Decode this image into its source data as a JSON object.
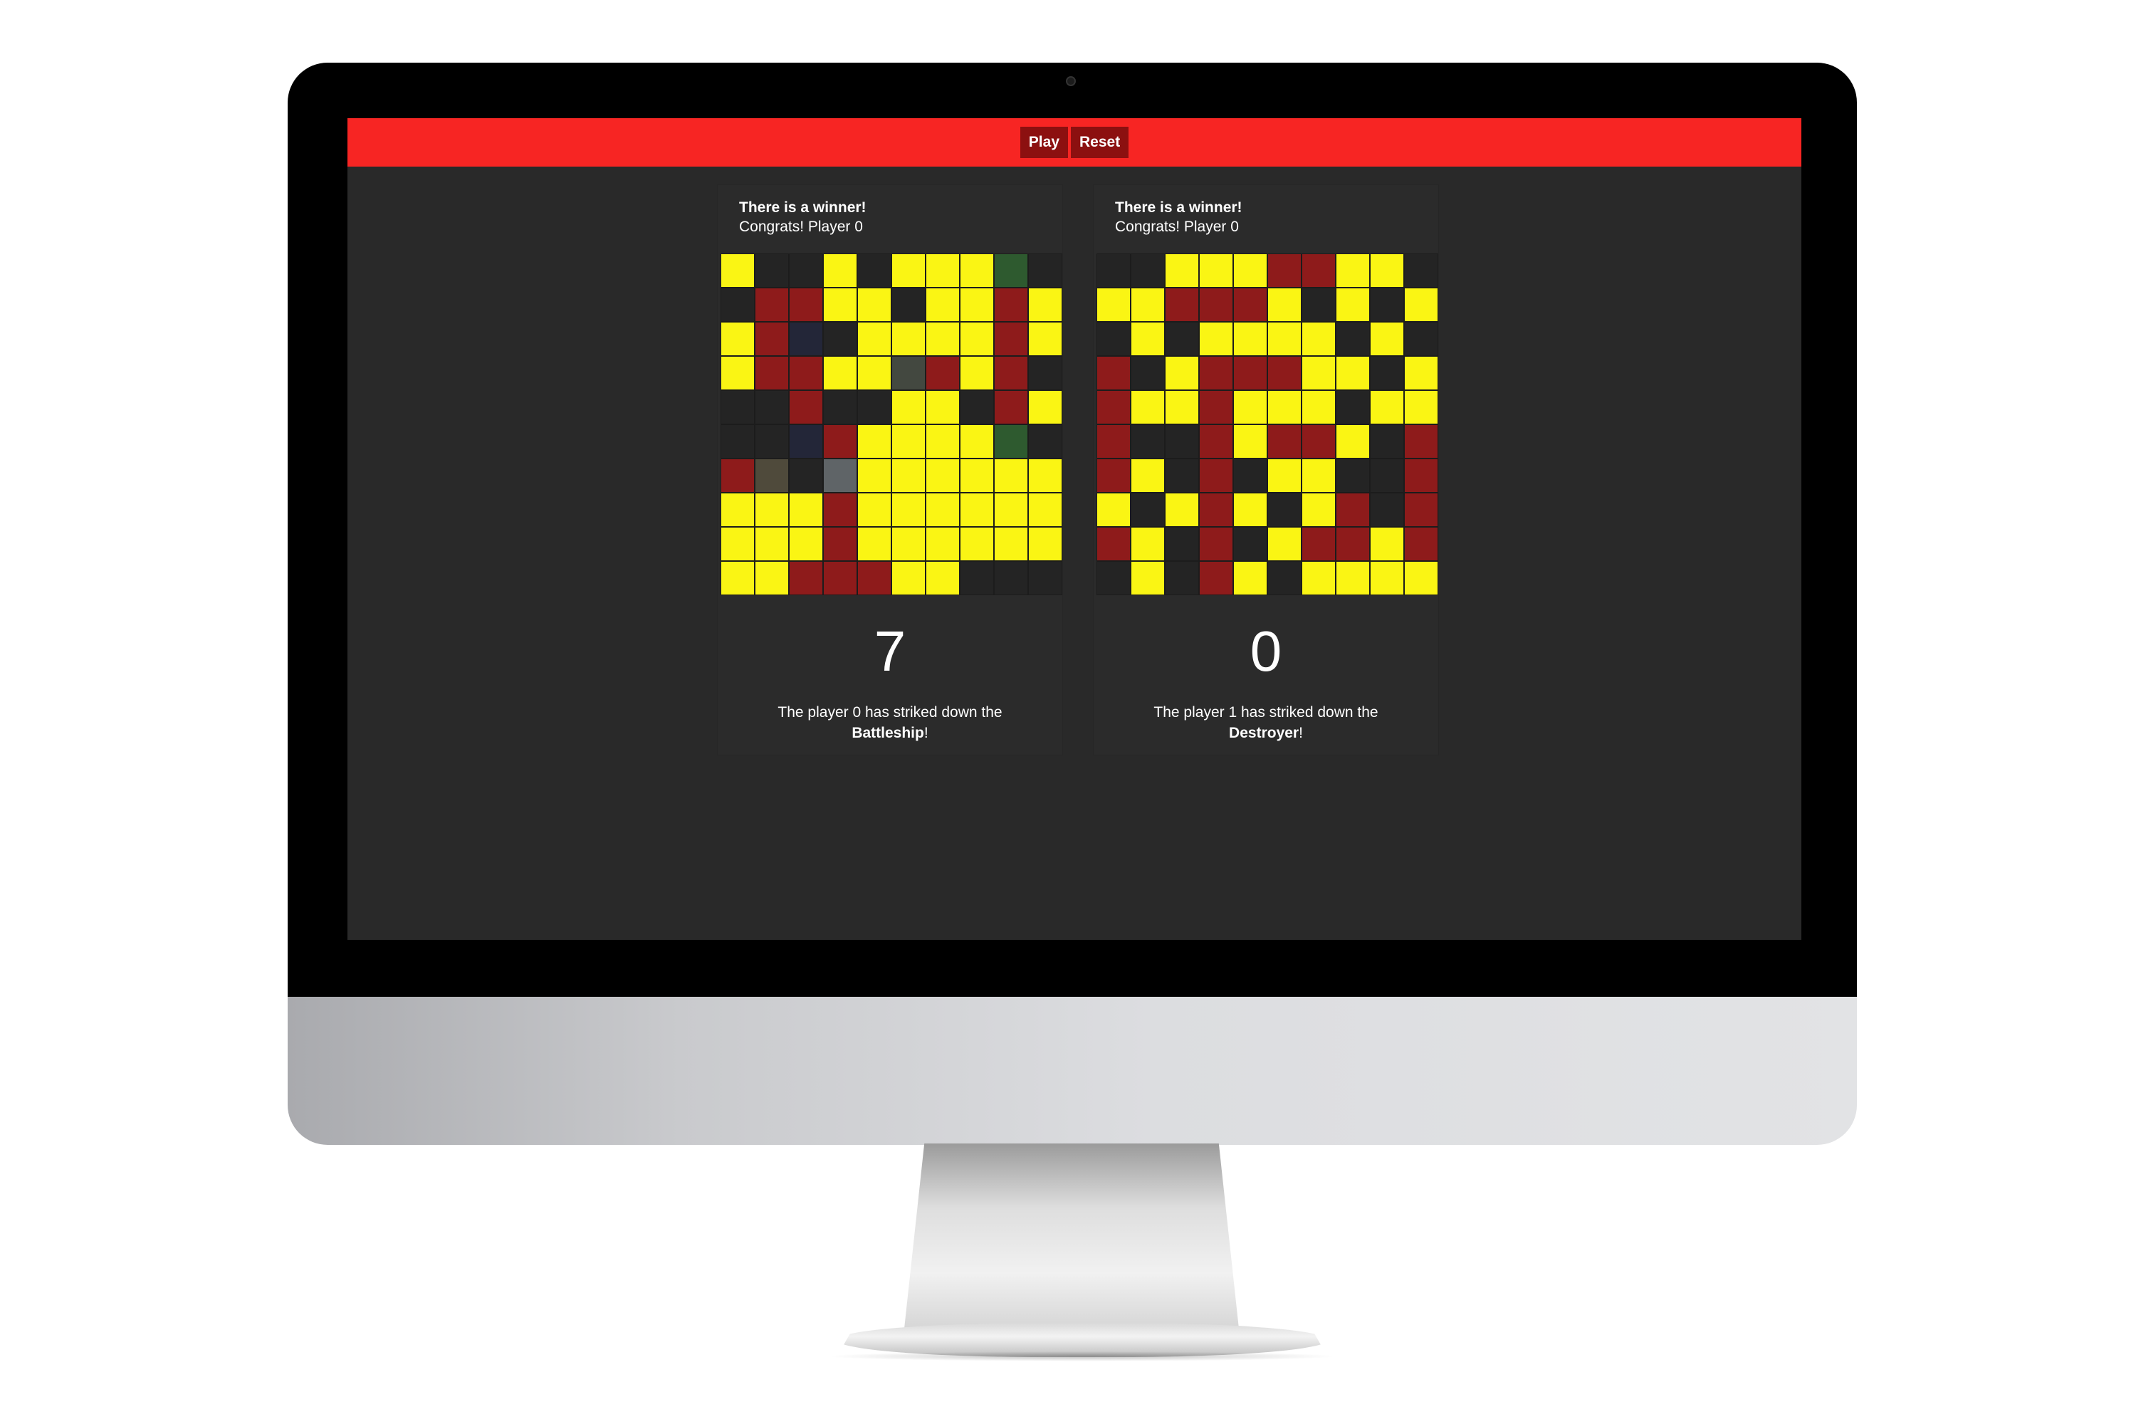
{
  "toolbar": {
    "play_label": "Play",
    "reset_label": "Reset"
  },
  "colors": {
    "bar": "#f72523",
    "button": "#8c1010",
    "background": "#292929",
    "Y": "#faf514",
    "R": "#8e1b1b",
    "K": "#242424",
    "G": "#2e5a2f",
    "N": "#232638",
    "D": "#434840",
    "O": "#4f4a3b",
    "S": "#5f6467"
  },
  "boards": [
    {
      "title": "There is a winner!",
      "subtitle": "Congrats! Player 0",
      "score": "7",
      "message_prefix": "The player 0 has striked down the",
      "ship": "Battleship",
      "message_suffix": "!",
      "grid": [
        "YKKYKYYYGK",
        "KRRYYKYYRY",
        "YRNKYYYYRY",
        "YRRYYDRYRK",
        "KKRKKYYKRY",
        "KKNRYYYYGK",
        "ROKSYYYYYY",
        "YYYRYYYYYY",
        "YYYRYYYYYY",
        "YYRRRYYKKK"
      ]
    },
    {
      "title": "There is a winner!",
      "subtitle": "Congrats! Player 0",
      "score": "0",
      "message_prefix": "The player 1 has striked down the",
      "ship": "Destroyer",
      "message_suffix": "!",
      "grid": [
        "KKYYYRRYYK",
        "YYRRRYKYKY",
        "KYKYYYYKYK",
        "RKYRRRYYKY",
        "RYYRYYYKYY",
        "RKKRYRRYKR",
        "RYKRKYYKKR",
        "YKYRYKYRKR",
        "RYKRKYRRYR",
        "KYKRYKYYYY"
      ]
    }
  ]
}
